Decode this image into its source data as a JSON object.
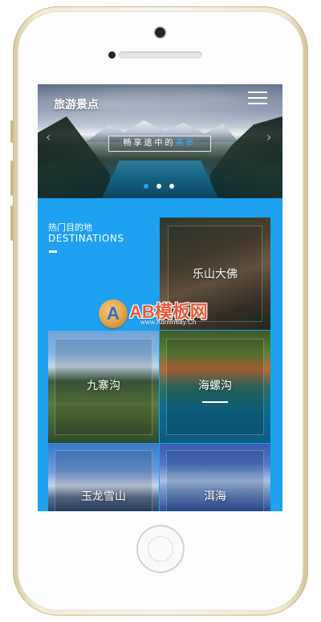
{
  "header": {
    "logo": "旅游景点"
  },
  "banner": {
    "slogan_prefix": "畅享途中的",
    "slogan_highlight": "美景",
    "prev_arrow": "‹",
    "next_arrow": "›",
    "dots": 3
  },
  "section": {
    "title_cn": "热门目的地",
    "title_en": "DESTINATIONS"
  },
  "destinations": [
    {
      "name": "乐山大佛"
    },
    {
      "name": "九寨沟"
    },
    {
      "name": "海螺沟"
    },
    {
      "name": "玉龙雪山"
    },
    {
      "name": "洱海"
    }
  ],
  "watermark": {
    "badge": "A",
    "title": "AB模板网",
    "url": "www.Admin8ay.Cn"
  },
  "colors": {
    "accent": "#1da1f0",
    "slogan_highlight": "#2fb1ff"
  }
}
